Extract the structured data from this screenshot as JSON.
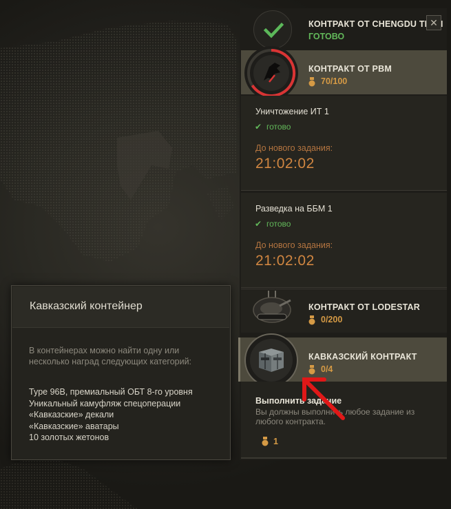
{
  "tooltip": {
    "title": "Кавказский контейнер",
    "description": "В контейнерах можно найти одну или несколько наград следующих категорий:",
    "rewards": [
      "Type 96B, премиальный ОБТ 8-го уровня",
      "Уникальный камуфляж спецоперации",
      "«Кавказские» декали",
      "«Кавказские» аватары",
      "10 золотых жетонов"
    ]
  },
  "contracts": {
    "chengdu": {
      "title": "КОНТРАКТ ОТ CHENGDU TECH",
      "status": "ГОТОВО",
      "icon": "checkmark-icon"
    },
    "pbm": {
      "title": "КОНТРАКТ ОТ PBM",
      "progress": "70/100",
      "progress_value": 0.7,
      "icon": "pbm-dragon-logo"
    },
    "lodestar": {
      "title": "КОНТРАКТ ОТ LODESTAR",
      "progress": "0/200",
      "icon": "tank-icon"
    },
    "caucasus": {
      "title": "КАВКАЗСКИЙ КОНТРАКТ",
      "progress": "0/4",
      "icon": "crate-icon"
    }
  },
  "tasks": [
    {
      "name": "Уничтожение ИТ 1",
      "status": "готово",
      "timer_label": "До нового задания:",
      "timer": "21:02:02"
    },
    {
      "name": "Разведка на ББМ 1",
      "status": "готово",
      "timer_label": "До нового задания:",
      "timer": "21:02:02"
    }
  ],
  "caucasus_task": {
    "title": "Выполнить задание",
    "description": "Вы должны выполнить любое задание из любого контракта.",
    "reward": "1"
  },
  "colors": {
    "accent_gold": "#d59a45",
    "ready_green": "#62b85a",
    "timer_orange": "#d08641",
    "arrow_red": "#e01818"
  }
}
